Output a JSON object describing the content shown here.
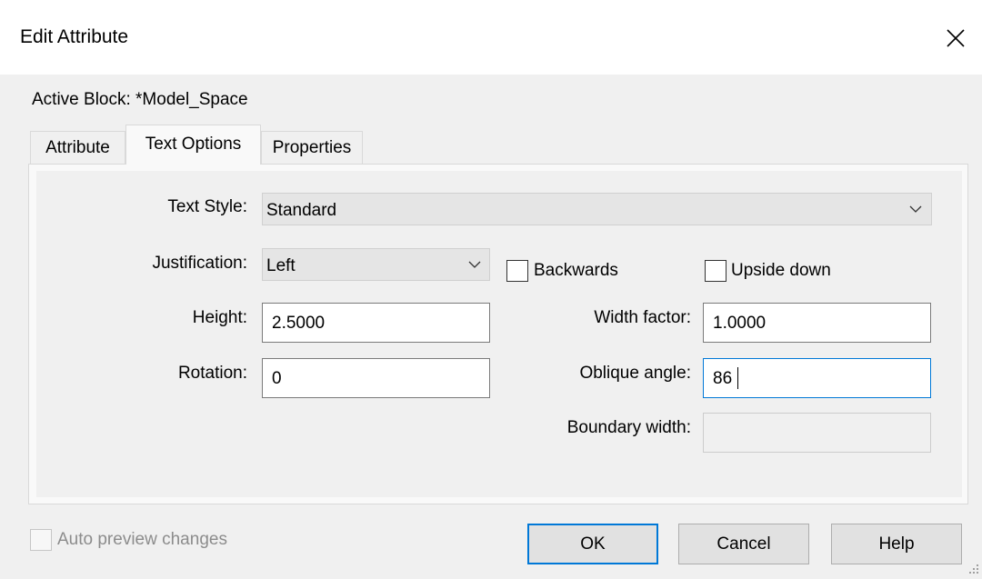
{
  "window": {
    "title": "Edit Attribute",
    "close_icon": "close-icon"
  },
  "active_block": "Active Block: *Model_Space",
  "tabs": [
    {
      "label": "Attribute",
      "active": false
    },
    {
      "label": "Text Options",
      "active": true
    },
    {
      "label": "Properties",
      "active": false
    }
  ],
  "text_options": {
    "text_style": {
      "label": "Text Style:",
      "value": "Standard"
    },
    "justification": {
      "label": "Justification:",
      "value": "Left"
    },
    "backwards": {
      "label": "Backwards",
      "checked": false
    },
    "upside_down": {
      "label": "Upside down",
      "checked": false
    },
    "height": {
      "label": "Height:",
      "value": "2.5000"
    },
    "width_factor": {
      "label": "Width factor:",
      "value": "1.0000"
    },
    "rotation": {
      "label": "Rotation:",
      "value": "0"
    },
    "oblique_angle": {
      "label": "Oblique angle:",
      "value": "86"
    },
    "boundary_width": {
      "label": "Boundary width:",
      "value": ""
    }
  },
  "auto_preview": {
    "label": "Auto preview changes",
    "checked": false,
    "enabled": false
  },
  "buttons": {
    "ok": "OK",
    "cancel": "Cancel",
    "help": "Help"
  },
  "colors": {
    "accent": "#0078d7",
    "button_bg": "#e1e1e1",
    "dialog_bg": "#f0f0f0"
  }
}
